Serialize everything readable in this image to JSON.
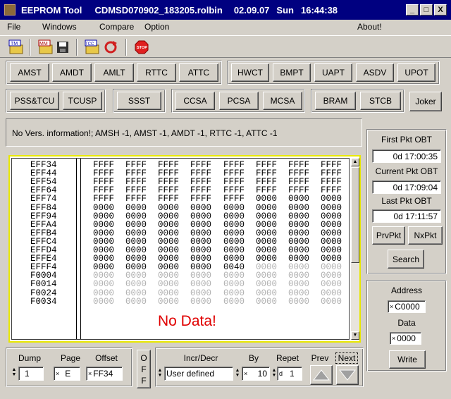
{
  "window": {
    "app": "EEPROM Tool",
    "file": "CDMSD070902_183205.rolbin",
    "date": "02.09.07",
    "day": "Sun",
    "time": "16:44:38",
    "btn_min": "_",
    "btn_max": "□",
    "btn_close": "X"
  },
  "menu": {
    "file": "File",
    "windows": "Windows",
    "compare": "Compare",
    "option": "Option",
    "about": "About!"
  },
  "toolbar": {
    "icons": [
      {
        "name": "tm-open-icon",
        "glyph": "TM"
      },
      {
        "name": "mm-open-icon",
        "glyph": "MM"
      },
      {
        "name": "save-icon",
        "glyph": "💾"
      },
      {
        "name": "tcc-open-icon",
        "glyph": "TCC"
      },
      {
        "name": "refresh-icon",
        "glyph": "↻"
      },
      {
        "name": "stop-icon",
        "glyph": "STOP"
      }
    ]
  },
  "row1_left": [
    "AMST",
    "AMDT",
    "AMLT",
    "RTTC",
    "ATTC"
  ],
  "row1_right": [
    "HWCT",
    "BMPT",
    "UAPT",
    "ASDV",
    "UPOT"
  ],
  "row2": {
    "g1": [
      "PSS&TCU",
      "TCUSP"
    ],
    "g2": [
      "SSST"
    ],
    "g3": [
      "CCSA",
      "PCSA",
      "MCSA"
    ],
    "g4": [
      "BRAM",
      "STCB"
    ],
    "joker": "Joker"
  },
  "info_text": "No Vers. information!; AMSH -1, AMST -1, AMDT -1, RTTC -1, ATTC -1",
  "dump": {
    "rows": [
      {
        "addr": "EFF34",
        "vals": [
          "FFFF",
          "FFFF",
          "FFFF",
          "FFFF",
          "FFFF",
          "FFFF",
          "FFFF",
          "FFFF"
        ]
      },
      {
        "addr": "EFF44",
        "vals": [
          "FFFF",
          "FFFF",
          "FFFF",
          "FFFF",
          "FFFF",
          "FFFF",
          "FFFF",
          "FFFF"
        ]
      },
      {
        "addr": "EFF54",
        "vals": [
          "FFFF",
          "FFFF",
          "FFFF",
          "FFFF",
          "FFFF",
          "FFFF",
          "FFFF",
          "FFFF"
        ]
      },
      {
        "addr": "EFF64",
        "vals": [
          "FFFF",
          "FFFF",
          "FFFF",
          "FFFF",
          "FFFF",
          "FFFF",
          "FFFF",
          "FFFF"
        ]
      },
      {
        "addr": "EFF74",
        "vals": [
          "FFFF",
          "FFFF",
          "FFFF",
          "FFFF",
          "FFFF",
          "0000",
          "0000",
          "0000"
        ]
      },
      {
        "addr": "EFF84",
        "vals": [
          "0000",
          "0000",
          "0000",
          "0000",
          "0000",
          "0000",
          "0000",
          "0000"
        ]
      },
      {
        "addr": "EFF94",
        "vals": [
          "0000",
          "0000",
          "0000",
          "0000",
          "0000",
          "0000",
          "0000",
          "0000"
        ]
      },
      {
        "addr": "EFFA4",
        "vals": [
          "0000",
          "0000",
          "0000",
          "0000",
          "0000",
          "0000",
          "0000",
          "0000"
        ]
      },
      {
        "addr": "EFFB4",
        "vals": [
          "0000",
          "0000",
          "0000",
          "0000",
          "0000",
          "0000",
          "0000",
          "0000"
        ]
      },
      {
        "addr": "EFFC4",
        "vals": [
          "0000",
          "0000",
          "0000",
          "0000",
          "0000",
          "0000",
          "0000",
          "0000"
        ]
      },
      {
        "addr": "EFFD4",
        "vals": [
          "0000",
          "0000",
          "0000",
          "0000",
          "0000",
          "0000",
          "0000",
          "0000"
        ]
      },
      {
        "addr": "EFFE4",
        "vals": [
          "0000",
          "0000",
          "0000",
          "0000",
          "0000",
          "0000",
          "0000",
          "0000"
        ]
      },
      {
        "addr": "EFFF4",
        "vals": [
          "0000",
          "0000",
          "0000",
          "0000",
          "0040",
          "0000",
          "0000",
          "0000"
        ]
      },
      {
        "addr": "F0004",
        "vals": [
          "0000",
          "0000",
          "0000",
          "0000",
          "0000",
          "0000",
          "0000",
          "0000"
        ]
      },
      {
        "addr": "F0014",
        "vals": [
          "0000",
          "0000",
          "0000",
          "0000",
          "0000",
          "0000",
          "0000",
          "0000"
        ]
      },
      {
        "addr": "F0024",
        "vals": [
          "0000",
          "0000",
          "0000",
          "0000",
          "0000",
          "0000",
          "0000",
          "0000"
        ]
      },
      {
        "addr": "F0034",
        "vals": [
          "0000",
          "0000",
          "0000",
          "0000",
          "0000",
          "0000",
          "0000",
          "0000"
        ]
      }
    ],
    "gray_from_row": 13,
    "gray_from_col_row12": 5,
    "no_data": "No Data!"
  },
  "right_panel": {
    "first_label": "First Pkt OBT",
    "first_val": "0d 17:00:35",
    "current_label": "Current Pkt OBT",
    "current_val": "0d 17:09:04",
    "last_label": "Last Pkt OBT",
    "last_val": "0d 17:11:57",
    "prev_btn": "PrvPkt",
    "next_btn": "NxPkt",
    "search_btn": "Search",
    "address_label": "Address",
    "address_val": "C0000",
    "data_label": "Data",
    "data_val": "0000",
    "write_btn": "Write"
  },
  "bottom": {
    "dump_label": "Dump",
    "dump_val": "1",
    "page_label": "Page",
    "page_val": "E",
    "offset_label": "Offset",
    "offset_val": "FF34",
    "off_btn": "OFF",
    "incr_label": "Incr/Decr",
    "incr_val": "User defined",
    "by_label": "By",
    "by_val": "10",
    "repet_label": "Repet",
    "repet_val": "1",
    "prev_label": "Prev",
    "next_label": "Next"
  }
}
